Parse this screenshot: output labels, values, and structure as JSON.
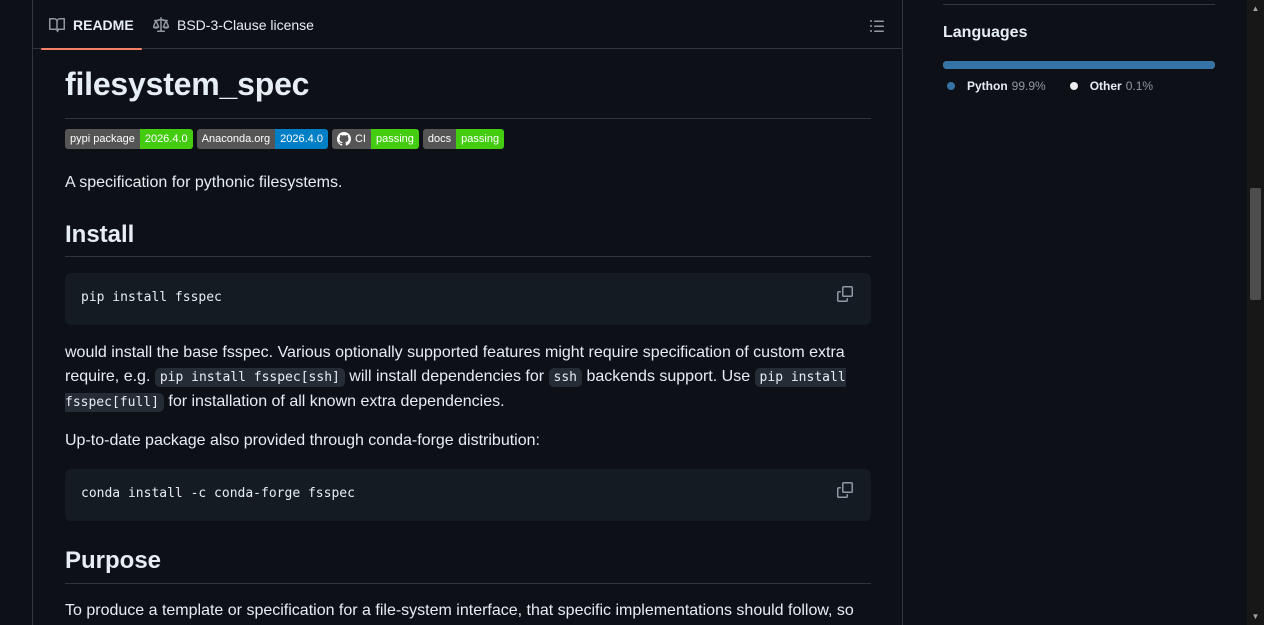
{
  "tabs": {
    "readme": "README",
    "license": "BSD-3-Clause license"
  },
  "readme": {
    "title": "filesystem_spec",
    "badges": [
      {
        "left": "pypi package",
        "right": "2026.4.0",
        "color": "#4c1"
      },
      {
        "left": "Anaconda.org",
        "right": "2026.4.0",
        "color": "#007ec6"
      },
      {
        "left": "CI",
        "right": "passing",
        "color": "#44cc11"
      },
      {
        "left": "docs",
        "right": "passing",
        "color": "#44cc11"
      }
    ],
    "intro": "A specification for pythonic filesystems.",
    "install_heading": "Install",
    "install_code": "pip install fsspec",
    "para1": {
      "t1": "would install the base fsspec. Various optionally supported features might require specification of custom extra require, e.g. ",
      "c1": "pip install fsspec[ssh]",
      "t2": " will install dependencies for ",
      "c2": "ssh",
      "t3": " backends support. Use ",
      "c3": "pip install fsspec[full]",
      "t4": " for installation of all known extra dependencies."
    },
    "conda_text": "Up-to-date package also provided through conda-forge distribution:",
    "conda_code": "conda install -c conda-forge fsspec",
    "purpose_heading": "Purpose",
    "purpose_text": "To produce a template or specification for a file-system interface, that specific implementations should follow, so"
  },
  "sidebar": {
    "languages_title": "Languages",
    "languages": [
      {
        "name": "Python",
        "percent": "99.9%",
        "value": 99.9,
        "color": "#3572a5"
      },
      {
        "name": "Other",
        "percent": "0.1%",
        "value": 0.1,
        "color": "#ededed"
      }
    ]
  }
}
